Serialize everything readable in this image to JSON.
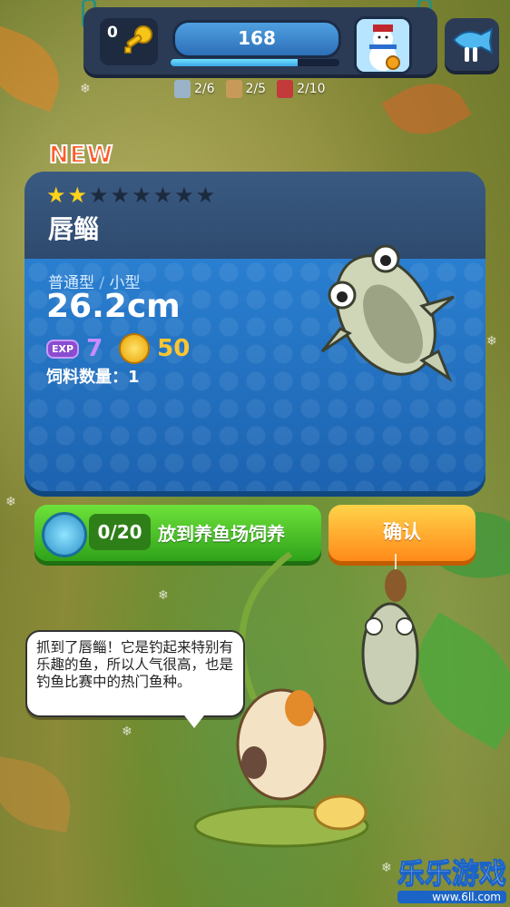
{
  "hud": {
    "key_count": "0",
    "main_value": "168",
    "progress_fraction": 0.75,
    "quests": [
      {
        "icon": "scroll-icon",
        "value": "2/6"
      },
      {
        "icon": "map-icon",
        "value": "2/5"
      },
      {
        "icon": "book-icon",
        "value": "2/10"
      }
    ]
  },
  "card": {
    "badge": "NEW",
    "stars_filled": 2,
    "stars_total": 8,
    "fish_name": "唇鲻",
    "category": "普通型",
    "separator": "/",
    "size_class": "小型",
    "length": "26.2cm",
    "exp_label": "EXP",
    "exp_value": "7",
    "coin_value": "50",
    "feed_text": "饲料数量：1"
  },
  "buttons": {
    "farm_count": "0/20",
    "farm_label": "放到养鱼场饲养",
    "confirm_label": "确认"
  },
  "speech": {
    "text": "抓到了唇鲻！它是钓起来特别有乐趣的鱼，所以人气很高，也是钓鱼比赛中的热门鱼种。"
  },
  "watermark": {
    "title": "乐乐游戏",
    "url": "www.6ll.com"
  },
  "colors": {
    "card_blue": "#1e6ab8",
    "farm_green": "#2fa21a",
    "confirm_orange": "#ff8a1a",
    "new_red": "#ff5a2a"
  }
}
